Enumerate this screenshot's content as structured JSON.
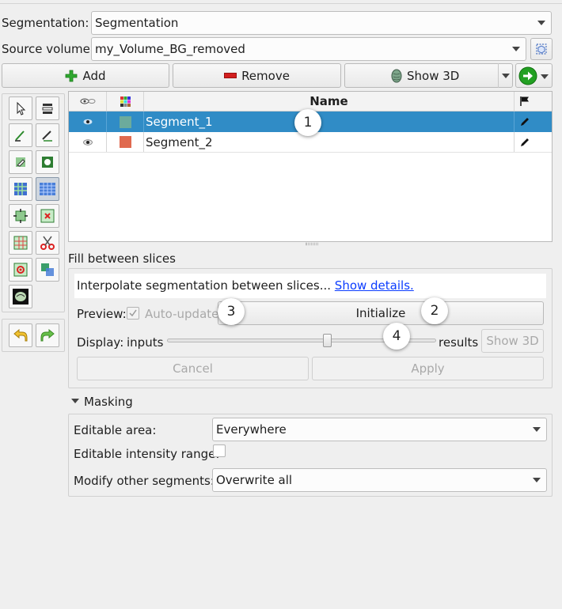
{
  "segmentation": {
    "label": "Segmentation:",
    "value": "Segmentation"
  },
  "source_volume": {
    "label": "Source volume:",
    "value": "my_Volume_BG_removed"
  },
  "toolbar": {
    "add_label": "Add",
    "remove_label": "Remove",
    "show3d_label": "Show 3D"
  },
  "table": {
    "header_name": "Name",
    "rows": [
      {
        "name": "Segment_1",
        "color": "#6cab9c",
        "selected": true
      },
      {
        "name": "Segment_2",
        "color": "#e06a4f",
        "selected": false
      }
    ]
  },
  "effect": {
    "title": "Fill between slices",
    "description": "Interpolate segmentation between slices...",
    "details_link": "Show details.",
    "preview_label": "Preview:",
    "auto_update_label": "Auto-update",
    "auto_update_checked": true,
    "initialize_label": "Initialize",
    "display_label": "Display:",
    "inputs_label": "inputs",
    "results_label": "results",
    "slider_fraction": 0.6,
    "show3d_label": "Show 3D",
    "cancel_label": "Cancel",
    "apply_label": "Apply"
  },
  "masking": {
    "title": "Masking",
    "editable_area_label": "Editable area:",
    "editable_area_value": "Everywhere",
    "intensity_label": "Editable intensity range:",
    "intensity_checked": false,
    "modify_label": "Modify other segments:",
    "modify_value": "Overwrite all"
  },
  "callouts": [
    "1",
    "2",
    "3",
    "4"
  ],
  "colors": {
    "selection": "#308cc6",
    "link": "#0b3cff"
  }
}
